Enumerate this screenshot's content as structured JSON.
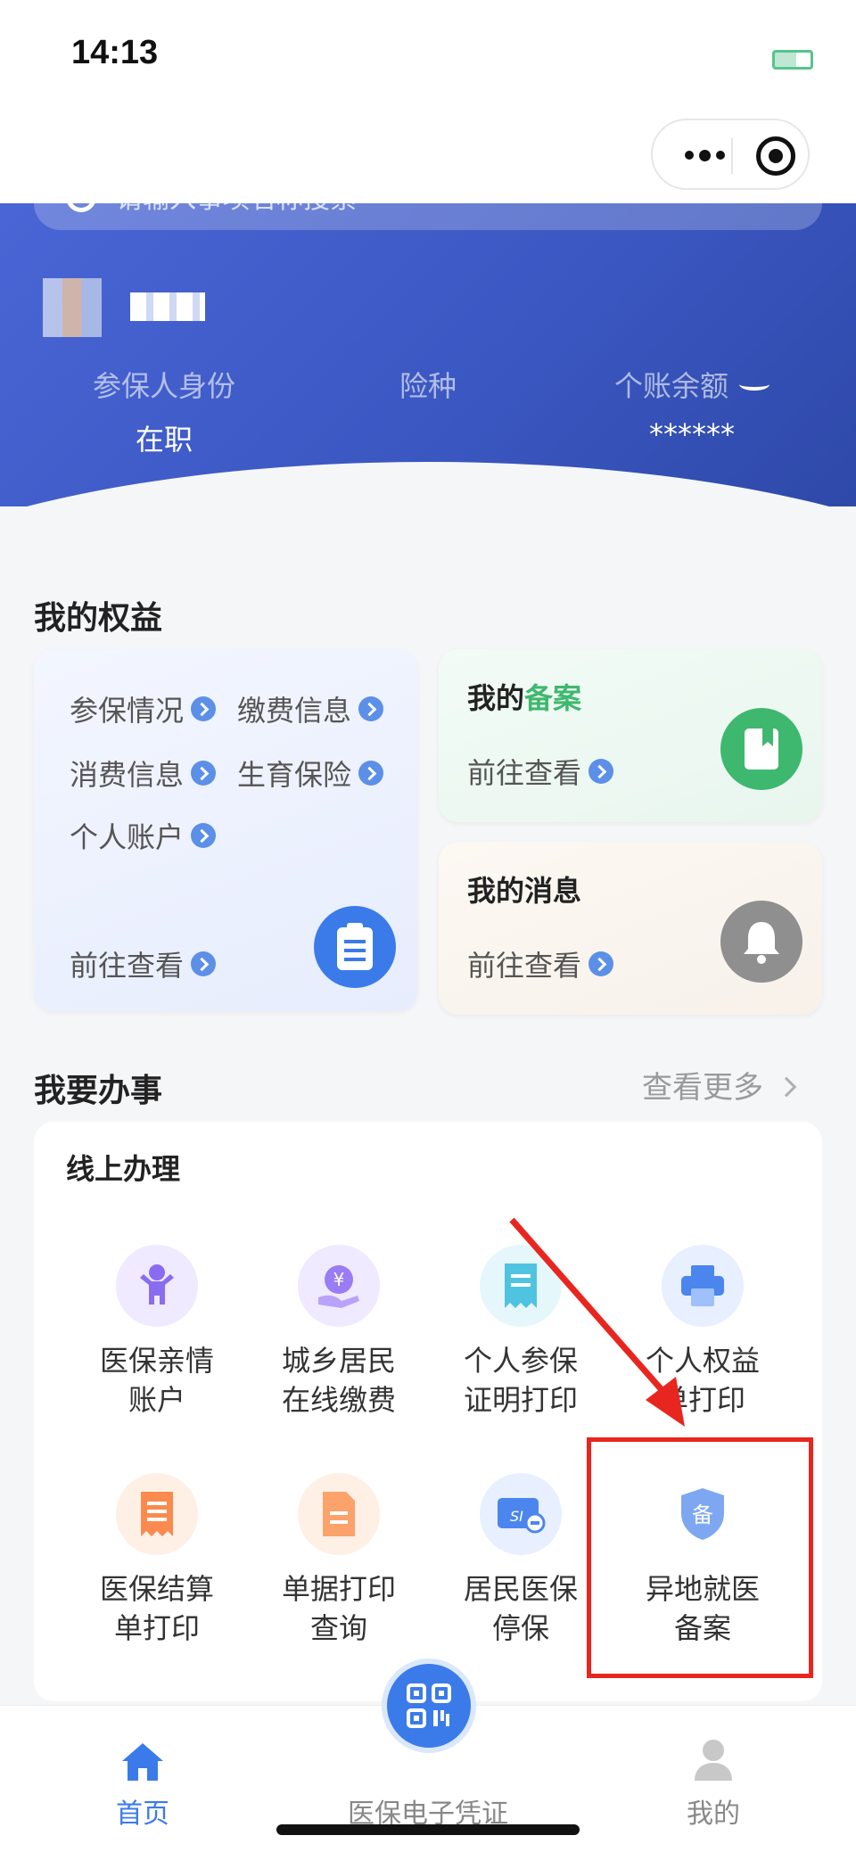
{
  "status": {
    "time": "14:13"
  },
  "search": {
    "placeholder": "请输入事项名称搜索"
  },
  "profile": {
    "labels": {
      "identity": "参保人身份",
      "insurance": "险种",
      "balance": "个账余额"
    },
    "values": {
      "identity": "在职",
      "insurance": "",
      "balance": "******"
    }
  },
  "benefits": {
    "title": "我的权益",
    "links": [
      "参保情况",
      "缴费信息",
      "消费信息",
      "生育保险",
      "个人账户"
    ],
    "goto": "前往查看",
    "record": {
      "title_prefix": "我的",
      "title_highlight": "备案",
      "goto": "前往查看"
    },
    "message": {
      "title": "我的消息",
      "goto": "前往查看"
    },
    "colors": {
      "accent": "#5c8fe8",
      "record_green": "#3fb86f"
    }
  },
  "services": {
    "title": "我要办事",
    "more": "查看更多",
    "group": "线上办理",
    "items": [
      {
        "label": "医保亲情\n账户",
        "icon": "family-icon"
      },
      {
        "label": "城乡居民\n在线缴费",
        "icon": "payment-icon"
      },
      {
        "label": "个人参保\n证明打印",
        "icon": "receipt-icon"
      },
      {
        "label": "个人权益\n单打印",
        "icon": "printer-icon"
      },
      {
        "label": "医保结算\n单打印",
        "icon": "settlement-icon"
      },
      {
        "label": "单据打印\n查询",
        "icon": "document-icon"
      },
      {
        "label": "居民医保\n停保",
        "icon": "stop-card-icon"
      },
      {
        "label": "异地就医\n备案",
        "icon": "shield-icon"
      }
    ],
    "shield_char": "备"
  },
  "tabbar": {
    "home": "首页",
    "center": "医保电子凭证",
    "mine": "我的",
    "active_color": "#3b7be9"
  }
}
